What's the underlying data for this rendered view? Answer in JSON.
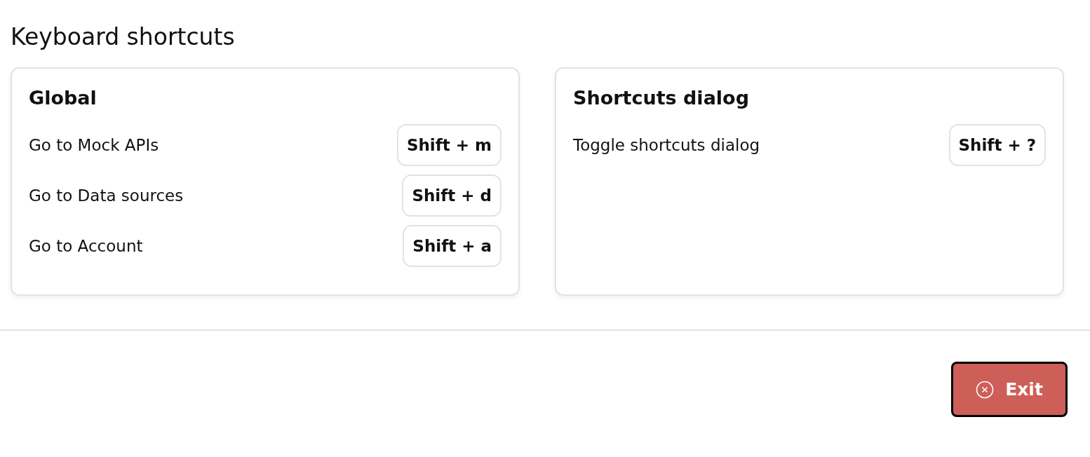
{
  "title": "Keyboard shortcuts",
  "sections": [
    {
      "heading": "Global",
      "shortcuts": [
        {
          "label": "Go to Mock APIs",
          "keys": "Shift + m"
        },
        {
          "label": "Go to Data sources",
          "keys": "Shift + d"
        },
        {
          "label": "Go to Account",
          "keys": "Shift + a"
        }
      ]
    },
    {
      "heading": "Shortcuts dialog",
      "shortcuts": [
        {
          "label": "Toggle shortcuts dialog",
          "keys": "Shift + ?"
        }
      ]
    }
  ],
  "exit_button": {
    "label": "Exit"
  }
}
